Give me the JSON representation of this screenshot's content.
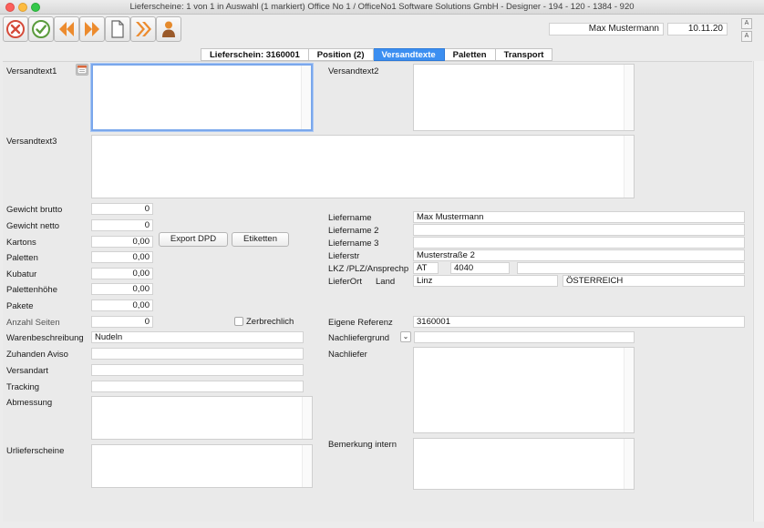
{
  "window": {
    "title": "Lieferscheine: 1 von 1 in Auswahl  (1 markiert) Office No 1 /  OfficeNo1 Software Solutions GmbH - Designer - 194 - 120 - 1384 - 920"
  },
  "toolbar": {
    "buttons": [
      {
        "icon": "cancel-icon"
      },
      {
        "icon": "confirm-icon"
      },
      {
        "icon": "previous-icon"
      },
      {
        "icon": "next-icon"
      },
      {
        "icon": "document-icon"
      },
      {
        "icon": "last-icon"
      },
      {
        "icon": "user-icon"
      }
    ],
    "user": "Max Mustermann",
    "date": "10.11.20"
  },
  "tabs": [
    {
      "label": "Lieferschein: 3160001",
      "active": false
    },
    {
      "label": "Position (2)",
      "active": false
    },
    {
      "label": "Versandtexte",
      "active": true
    },
    {
      "label": "Paletten",
      "active": false
    },
    {
      "label": "Transport",
      "active": false
    }
  ],
  "texts": {
    "versandtext1": "Versandtext1",
    "versandtext2": "Versandtext2",
    "versandtext3": "Versandtext3"
  },
  "left": {
    "gewicht_brutto": {
      "label": "Gewicht brutto",
      "value": "0"
    },
    "gewicht_netto": {
      "label": "Gewicht netto",
      "value": "0"
    },
    "kartons": {
      "label": "Kartons",
      "value": "0,00"
    },
    "paletten": {
      "label": "Paletten",
      "value": "0,00"
    },
    "kubatur": {
      "label": "Kubatur",
      "value": "0,00"
    },
    "palettenhoehe": {
      "label": "Palettenhöhe",
      "value": "0,00"
    },
    "pakete": {
      "label": "Pakete",
      "value": "0,00"
    },
    "anzahl_seiten": {
      "label": "Anzahl Seiten",
      "value": "0"
    },
    "zerbrechlich": "Zerbrechlich",
    "warenbeschreibung": {
      "label": "Warenbeschreibung",
      "value": "Nudeln"
    },
    "zuhanden_aviso": {
      "label": "Zuhanden Aviso",
      "value": ""
    },
    "versandart": {
      "label": "Versandart",
      "value": ""
    },
    "tracking": {
      "label": "Tracking",
      "value": ""
    },
    "abmessung": "Abmessung",
    "urlieferscheine": "Urlieferscheine"
  },
  "buttons": {
    "export_dpd": "Export DPD",
    "etiketten": "Etiketten"
  },
  "right": {
    "liefername": {
      "label": "Liefername",
      "value": "Max Mustermann"
    },
    "liefername2": {
      "label": "Liefername 2",
      "value": ""
    },
    "liefername3": {
      "label": "Liefername 3",
      "value": ""
    },
    "lieferstr": {
      "label": "Lieferstr",
      "value": "Musterstraße 2"
    },
    "lkz": {
      "label": "LKZ /PLZ/Ansprechp",
      "lkz": "AT",
      "plz": "4040",
      "ansprech": ""
    },
    "lieferort": {
      "label": "LieferOrt",
      "land_label": "Land",
      "ort": "Linz",
      "land": "ÖSTERREICH"
    },
    "eigene_referenz": {
      "label": "Eigene Referenz",
      "value": "3160001"
    },
    "nachliefergrund": {
      "label": "Nachliefergrund",
      "value": ""
    },
    "nachliefer": "Nachliefer",
    "bemerkung_intern": "Bemerkung intern"
  }
}
